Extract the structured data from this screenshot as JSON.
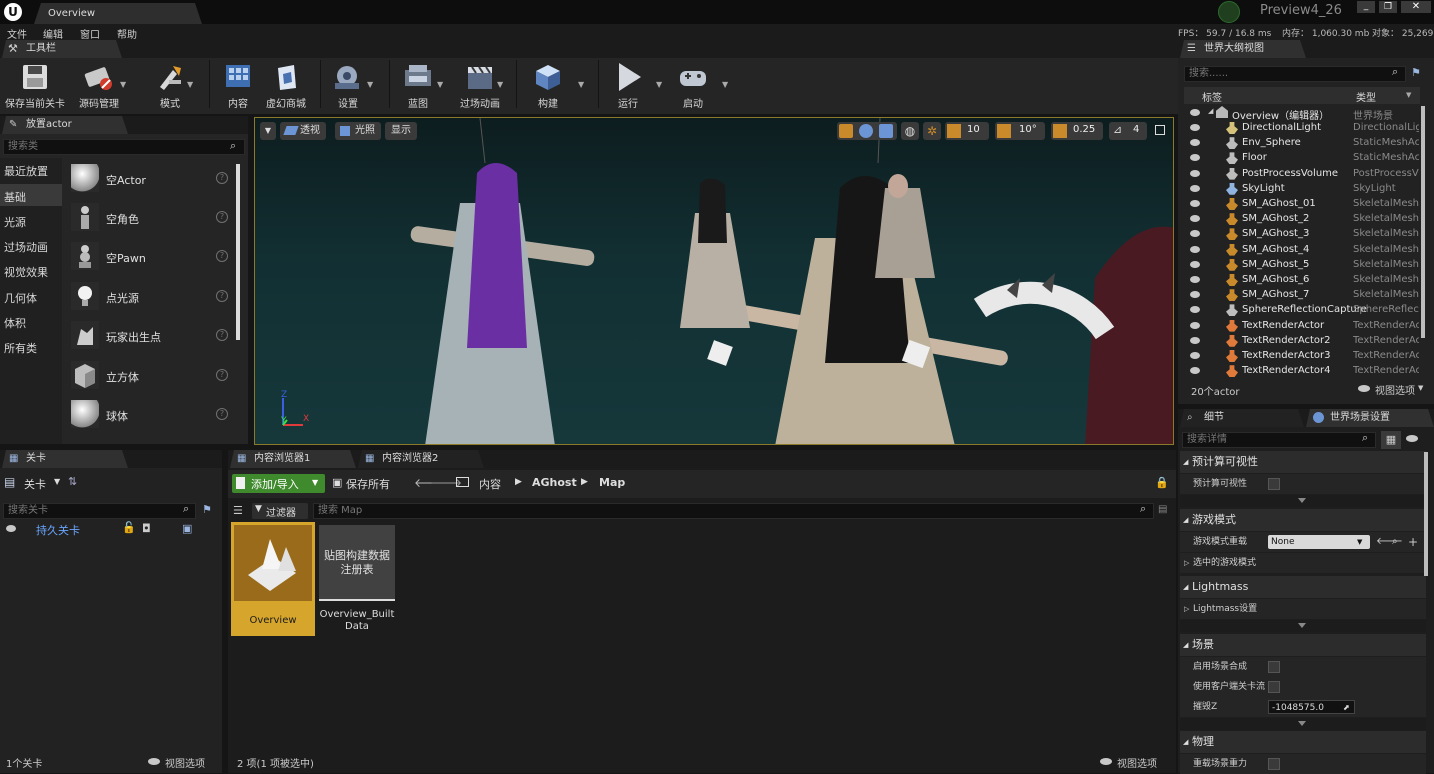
{
  "window": {
    "doc_tab": "Overview",
    "project": "Preview4_26"
  },
  "menu": [
    "文件",
    "编辑",
    "窗口",
    "帮助"
  ],
  "stats": {
    "fps": "FPS： 59.7 / 16.8 ms",
    "mem": "内存： 1,060.30 mb",
    "obj": "对象： 25,269"
  },
  "toolbar": {
    "tab": "工具栏",
    "buttons": [
      "保存当前关卡",
      "源码管理",
      "模式",
      "内容",
      "虚幻商城",
      "设置",
      "蓝图",
      "过场动画",
      "构建",
      "运行",
      "启动"
    ]
  },
  "place": {
    "tab": "放置actor",
    "search_placeholder": "搜索类",
    "categories": [
      "最近放置",
      "基础",
      "光源",
      "过场动画",
      "视觉效果",
      "几何体",
      "体积",
      "所有类"
    ],
    "selected_category": "基础",
    "items": [
      "空Actor",
      "空角色",
      "空Pawn",
      "点光源",
      "玩家出生点",
      "立方体",
      "球体"
    ]
  },
  "viewport": {
    "view_mode": "透视",
    "lit_mode": "光照",
    "show": "显示",
    "grid_snap": "10",
    "rot_snap": "10°",
    "scale_snap": "0.25",
    "cam_speed": "4",
    "axis_labels": [
      "Z",
      "Y",
      "X"
    ]
  },
  "levels": {
    "tab": "关卡",
    "dropdown": "关卡",
    "search_placeholder": "搜索关卡",
    "persistent": "持久关卡",
    "count": "1个关卡",
    "view_options": "视图选项"
  },
  "content": {
    "tabs": [
      "内容浏览器1",
      "内容浏览器2"
    ],
    "add_import": "添加/导入",
    "save_all": "保存所有",
    "path": [
      "内容",
      "AGhost",
      "Map"
    ],
    "filters": "过滤器",
    "search_placeholder": "搜索 Map",
    "assets": [
      {
        "name": "Overview",
        "selected": true
      },
      {
        "name": "Overview_BuiltData",
        "thumb_text": "贴图构建数据注册表",
        "selected": false
      }
    ],
    "status": "2 项(1 项被选中)",
    "view_options": "视图选项"
  },
  "outliner": {
    "tab": "世界大纲视图",
    "search_placeholder": "搜索......",
    "col_label": "标签",
    "col_type": "类型",
    "root": {
      "name": "Overview（编辑器）",
      "type": "世界场景"
    },
    "rows": [
      {
        "name": "DirectionalLight",
        "type": "DirectionalLig"
      },
      {
        "name": "Env_Sphere",
        "type": "StaticMeshAc"
      },
      {
        "name": "Floor",
        "type": "StaticMeshAc"
      },
      {
        "name": "PostProcessVolume",
        "type": "PostProcessV"
      },
      {
        "name": "SkyLight",
        "type": "SkyLight"
      },
      {
        "name": "SM_AGhost_01",
        "type": "SkeletalMesh."
      },
      {
        "name": "SM_AGhost_2",
        "type": "SkeletalMesh."
      },
      {
        "name": "SM_AGhost_3",
        "type": "SkeletalMesh."
      },
      {
        "name": "SM_AGhost_4",
        "type": "SkeletalMesh."
      },
      {
        "name": "SM_AGhost_5",
        "type": "SkeletalMesh."
      },
      {
        "name": "SM_AGhost_6",
        "type": "SkeletalMesh."
      },
      {
        "name": "SM_AGhost_7",
        "type": "SkeletalMesh."
      },
      {
        "name": "SphereReflectionCapture",
        "type": "SphereReflect"
      },
      {
        "name": "TextRenderActor",
        "type": "TextRenderAc"
      },
      {
        "name": "TextRenderActor2",
        "type": "TextRenderAc"
      },
      {
        "name": "TextRenderActor3",
        "type": "TextRenderAc"
      },
      {
        "name": "TextRenderActor4",
        "type": "TextRenderAc"
      }
    ],
    "count": "20个actor",
    "view_options": "视图选项"
  },
  "details": {
    "tabs": [
      "细节",
      "世界场景设置"
    ],
    "search_placeholder": "搜索详情",
    "sections": {
      "precomputed": "预计算可视性",
      "precomputed_row": "预计算可视性",
      "gamemode": "游戏模式",
      "gamemode_override": "游戏模式重载",
      "gamemode_value": "None",
      "selected_gamemode": "选中的游戏模式",
      "lightmass": "Lightmass",
      "lightmass_settings": "Lightmass设置",
      "world": "场景",
      "enable_composition": "启用场景合成",
      "client_streaming": "使用客户端关卡流",
      "kill_z": "摧毁Z",
      "kill_z_value": "-1048575.0",
      "physics": "物理",
      "override_gravity": "重载场景重力"
    }
  }
}
